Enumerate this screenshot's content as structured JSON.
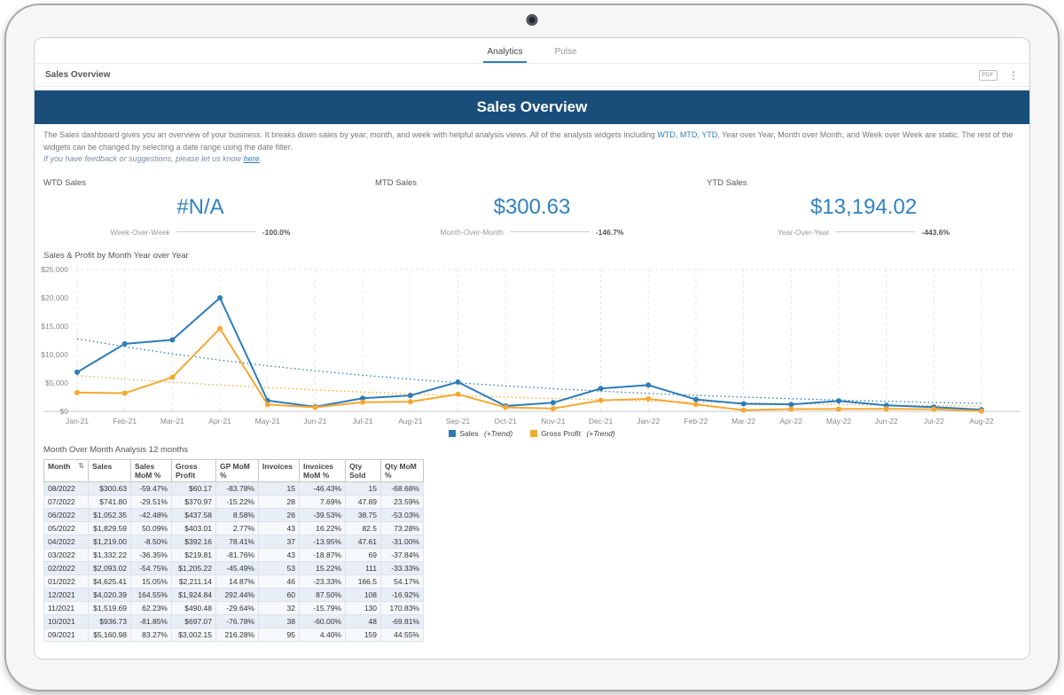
{
  "tabs": [
    {
      "label": "Analytics",
      "active": true
    },
    {
      "label": "Pulse",
      "active": false
    }
  ],
  "breadcrumb": {
    "title": "Sales Overview"
  },
  "icons": {
    "export_label": "PDF",
    "menu_glyph": "⋮",
    "sort_glyph": "⇅"
  },
  "header": {
    "title": "Sales Overview"
  },
  "description": {
    "line1_prefix": "The Sales dashboard gives you an overview of your business. It breaks down sales by year, month, and week with helpful analysis views. All of the analysis widgets including ",
    "line1_highlight": "WTD, MTD, YTD",
    "line1_suffix": ", Year over Year, Month over Month, and Week over Week are static. The rest of the widgets can be changed by selecting a date range using the date filter.",
    "line2_prefix": "If you have feedback or suggestions, please let us know ",
    "line2_link": "here",
    "line2_suffix": "."
  },
  "kpis": [
    {
      "label": "WTD Sales",
      "value": "#N/A",
      "compare_label": "Week-Over-Week",
      "compare_value": "-100.0%"
    },
    {
      "label": "MTD Sales",
      "value": "$300.63",
      "compare_label": "Month-Over-Month",
      "compare_value": "-146.7%"
    },
    {
      "label": "YTD Sales",
      "value": "$13,194.02",
      "compare_label": "Year-Over-Year",
      "compare_value": "-443.6%"
    }
  ],
  "chart": {
    "title": "Sales & Profit by Month Year over Year",
    "legend": [
      {
        "name": "Sales",
        "suffix": "(+Trend)",
        "color": "#2d7cb9"
      },
      {
        "name": "Gross Profit",
        "suffix": "(+Trend)",
        "color": "#f5a832"
      }
    ]
  },
  "chart_data": {
    "type": "line",
    "title": "Sales & Profit by Month Year over Year",
    "x": [
      "Jan-21",
      "Feb-21",
      "Mar-21",
      "Apr-21",
      "May-21",
      "Jun-21",
      "Jul-21",
      "Aug-21",
      "Sep-21",
      "Oct-21",
      "Nov-21",
      "Dec-21",
      "Jan-22",
      "Feb-22",
      "Mar-22",
      "Apr-22",
      "May-22",
      "Jun-22",
      "Jul-22",
      "Aug-22"
    ],
    "ylim": [
      0,
      25000
    ],
    "yticks": [
      "$0",
      "$5,000",
      "$10,000",
      "$15,000",
      "$20,000",
      "$25,000"
    ],
    "grid": "vertical-dashed",
    "legend_position": "bottom",
    "series": [
      {
        "name": "Sales",
        "color": "#2d7cb9",
        "style": "solid",
        "values": [
          6900,
          11900,
          12600,
          20000,
          1900,
          800,
          2300,
          2800,
          5161,
          937,
          1520,
          4020,
          4625,
          2093,
          1332,
          1219,
          1830,
          1052,
          742,
          301
        ]
      },
      {
        "name": "Gross Profit",
        "color": "#f5a832",
        "style": "solid",
        "values": [
          3300,
          3200,
          6000,
          14600,
          1200,
          700,
          1600,
          1700,
          3002,
          697,
          490,
          1925,
          2211,
          1205,
          220,
          392,
          403,
          438,
          371,
          60
        ]
      },
      {
        "name": "Sales Trend",
        "color": "#2d7cb9",
        "style": "dotted",
        "values": [
          12800,
          11392,
          10139,
          9024,
          8031,
          7148,
          6362,
          5662,
          5039,
          4485,
          3992,
          3553,
          3162,
          2814,
          2504,
          2229,
          1984,
          1766,
          1572,
          1399
        ]
      },
      {
        "name": "Gross Profit Trend",
        "color": "#f5a832",
        "style": "dotted",
        "values": [
          6300,
          5687,
          5133,
          4634,
          4183,
          3776,
          3408,
          3077,
          2777,
          2507,
          2263,
          2043,
          1844,
          1665,
          1503,
          1356,
          1224,
          1105,
          998,
          900
        ]
      }
    ]
  },
  "table": {
    "title": "Month Over Month Analysis 12 months",
    "columns": [
      "Month",
      "Sales",
      "Sales MoM %",
      "Gross Profit",
      "GP MoM %",
      "Invoices",
      "Invoices MoM %",
      "Qty Sold",
      "Qty MoM %"
    ],
    "rows": [
      [
        "08/2022",
        "$300.63",
        "-59.47%",
        "$60.17",
        "-83.78%",
        "15",
        "-46.43%",
        "15",
        "-68.68%"
      ],
      [
        "07/2022",
        "$741.80",
        "-29.51%",
        "$370.97",
        "-15.22%",
        "28",
        "7.69%",
        "47.89",
        "23.59%"
      ],
      [
        "06/2022",
        "$1,052.35",
        "-42.48%",
        "$437.58",
        "8.58%",
        "26",
        "-39.53%",
        "38.75",
        "-53.03%"
      ],
      [
        "05/2022",
        "$1,829.59",
        "50.09%",
        "$403.01",
        "2.77%",
        "43",
        "16.22%",
        "82.5",
        "73.28%"
      ],
      [
        "04/2022",
        "$1,219.00",
        "-8.50%",
        "$392.16",
        "78.41%",
        "37",
        "-13.95%",
        "47.61",
        "-31.00%"
      ],
      [
        "03/2022",
        "$1,332.22",
        "-36.35%",
        "$219.81",
        "-81.76%",
        "43",
        "-18.87%",
        "69",
        "-37.84%"
      ],
      [
        "02/2022",
        "$2,093.02",
        "-54.75%",
        "$1,205.22",
        "-45.49%",
        "53",
        "15.22%",
        "111",
        "-33.33%"
      ],
      [
        "01/2022",
        "$4,625.41",
        "15.05%",
        "$2,211.14",
        "14.87%",
        "46",
        "-23.33%",
        "166.5",
        "54.17%"
      ],
      [
        "12/2021",
        "$4,020.39",
        "164.55%",
        "$1,924.84",
        "292.44%",
        "60",
        "87.50%",
        "108",
        "-16.92%"
      ],
      [
        "11/2021",
        "$1,519.69",
        "62.23%",
        "$490.48",
        "-29.64%",
        "32",
        "-15.79%",
        "130",
        "170.83%"
      ],
      [
        "10/2021",
        "$936.73",
        "-81.85%",
        "$697.07",
        "-76.78%",
        "38",
        "-60.00%",
        "48",
        "-69.81%"
      ],
      [
        "09/2021",
        "$5,160.98",
        "83.27%",
        "$3,002.15",
        "216.28%",
        "95",
        "4.40%",
        "159",
        "44.55%"
      ]
    ]
  }
}
